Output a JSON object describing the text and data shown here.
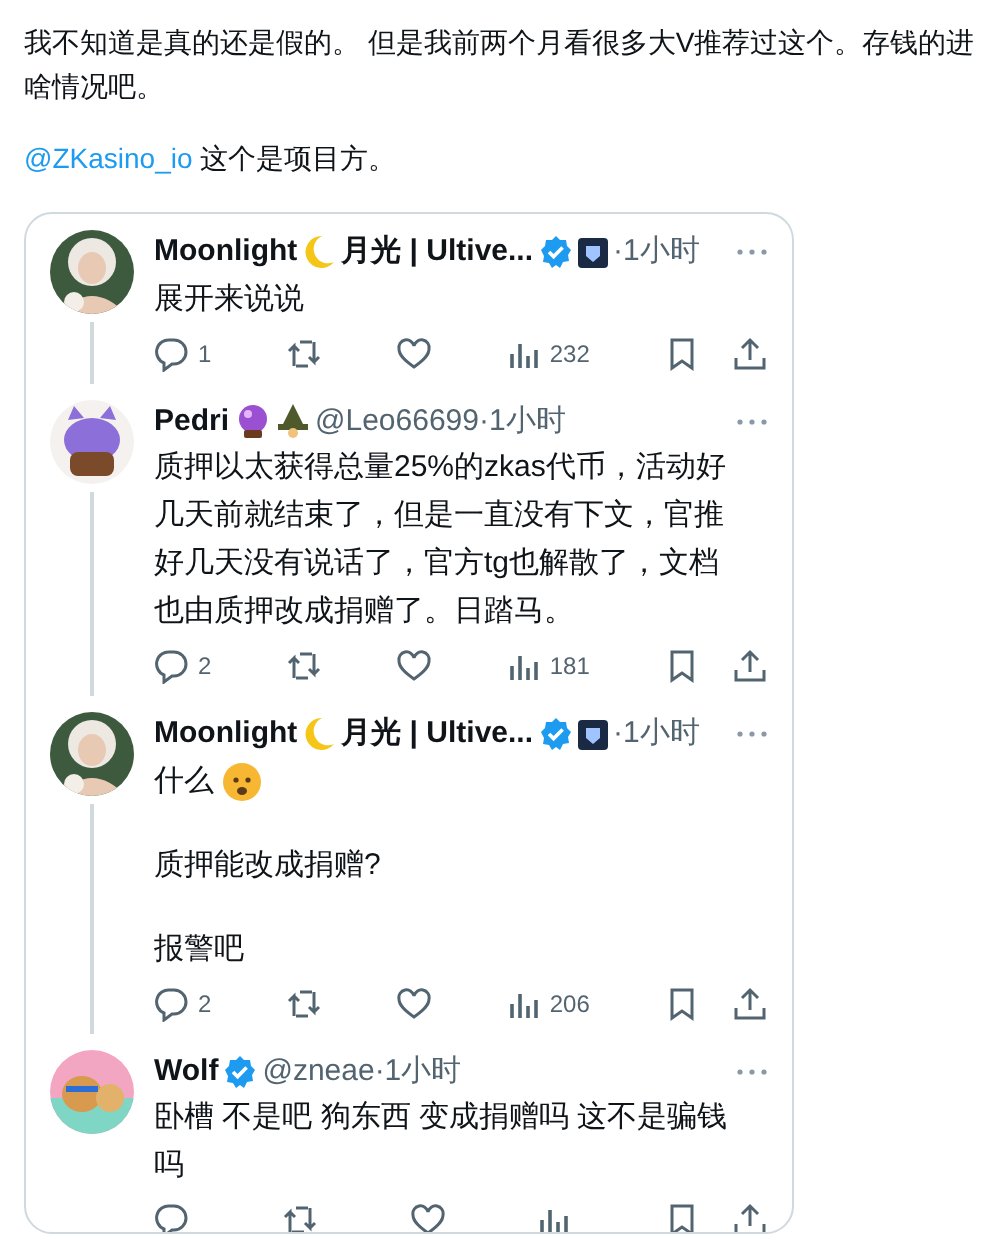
{
  "post": {
    "lines": [
      "我不知道是真的还是假的。 但是我前两个月看很多大V推荐过这个。存钱的进",
      "啥情况吧。"
    ],
    "mention": "@ZKasino_io",
    "mention_text": "这个是项目方。"
  },
  "replies": [
    {
      "name": "Moonlight",
      "name_icons": [
        {
          "kind": "moon"
        }
      ],
      "name_suffix": "月光 | Ultive...",
      "badges": [
        {
          "kind": "verified"
        },
        {
          "kind": "app"
        }
      ],
      "meta": "·1小时",
      "paragraphs": [
        {
          "text": "展开来说说",
          "emoji": false
        }
      ],
      "replies_count": "1",
      "views": "232",
      "thread": true
    },
    {
      "name": "Pedri",
      "name_icons": [
        {
          "kind": "crystal"
        },
        {
          "kind": "wizard"
        }
      ],
      "meta": "@Leo66699·1小时",
      "paragraphs": [
        {
          "text": "质押以太获得总量25%的zkas代币，活动好几天前就结束了，但是一直没有下文，官推好几天没有说话了，官方tg也解散了，文档也由质押改成捐赠了。日踏马。",
          "emoji": false
        }
      ],
      "replies_count": "2",
      "views": "181",
      "thread": true
    },
    {
      "name": "Moonlight",
      "name_icons": [
        {
          "kind": "moon"
        }
      ],
      "name_suffix": "月光 | Ultive...",
      "badges": [
        {
          "kind": "verified"
        },
        {
          "kind": "app"
        }
      ],
      "meta": "·1小时",
      "paragraphs": [
        {
          "text": "什么",
          "emoji": true
        },
        {
          "text": "质押能改成捐赠?",
          "emoji": false
        },
        {
          "text": "报警吧",
          "emoji": false
        }
      ],
      "replies_count": "2",
      "views": "206",
      "thread": true
    },
    {
      "name": "Wolf",
      "badges": [
        {
          "kind": "verified"
        }
      ],
      "meta": "@zneae·1小时",
      "paragraphs": [
        {
          "text": "卧槽 不是吧 狗东西 变成捐赠吗 这不是骗钱吗",
          "emoji": false
        }
      ],
      "thread": false
    }
  ]
}
